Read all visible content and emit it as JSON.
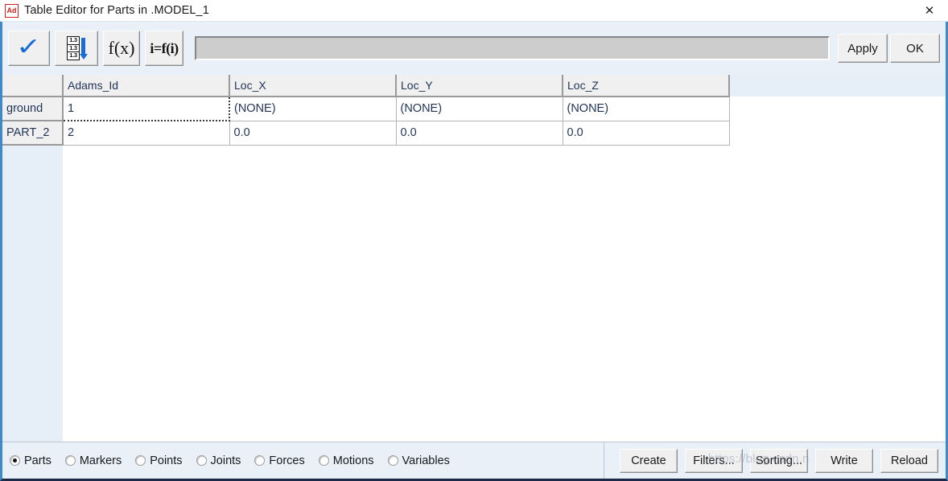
{
  "window": {
    "app_icon_label": "Ad",
    "title": "Table Editor for Parts in .MODEL_1",
    "close_label": "✕"
  },
  "toolbar": {
    "check_button": {
      "name": "apply-check-icon",
      "glyph": "✓"
    },
    "fill_down_button": {
      "name": "fill-down-icon",
      "cells": [
        "1.3",
        "1.3",
        "1.3"
      ]
    },
    "function_button": {
      "name": "function-fx-icon",
      "label": "f(x)"
    },
    "iterative_button": {
      "name": "iterative-function-icon",
      "label": "i=f(i)"
    },
    "formula_field": {
      "value": "",
      "placeholder": ""
    },
    "apply_label": "Apply",
    "ok_label": "OK"
  },
  "table": {
    "corner_label": "",
    "columns": [
      "Adams_Id",
      "Loc_X",
      "Loc_Y",
      "Loc_Z"
    ],
    "rows": [
      {
        "header": "ground",
        "cells": [
          "1",
          "(NONE)",
          "(NONE)",
          "(NONE)"
        ]
      },
      {
        "header": "PART_2",
        "cells": [
          "2",
          "0.0",
          "0.0",
          "0.0"
        ]
      }
    ],
    "selected_cell": {
      "row": 0,
      "col": 0
    }
  },
  "bottom": {
    "entity_types": [
      {
        "label": "Parts",
        "checked": true
      },
      {
        "label": "Markers",
        "checked": false
      },
      {
        "label": "Points",
        "checked": false
      },
      {
        "label": "Joints",
        "checked": false
      },
      {
        "label": "Forces",
        "checked": false
      },
      {
        "label": "Motions",
        "checked": false
      },
      {
        "label": "Variables",
        "checked": false
      }
    ],
    "actions": [
      "Create",
      "Filters...",
      "Sorting...",
      "Write",
      "Reload"
    ]
  },
  "watermark": {
    "text": "https://blog.csdn.n"
  },
  "colors": {
    "window_border": "#3d89c9",
    "toolbar_bg": "#eaf0f8",
    "header_cell_bg": "#f0f0f0",
    "text_navy": "#1f3356",
    "accent_blue": "#1b6bd6"
  }
}
